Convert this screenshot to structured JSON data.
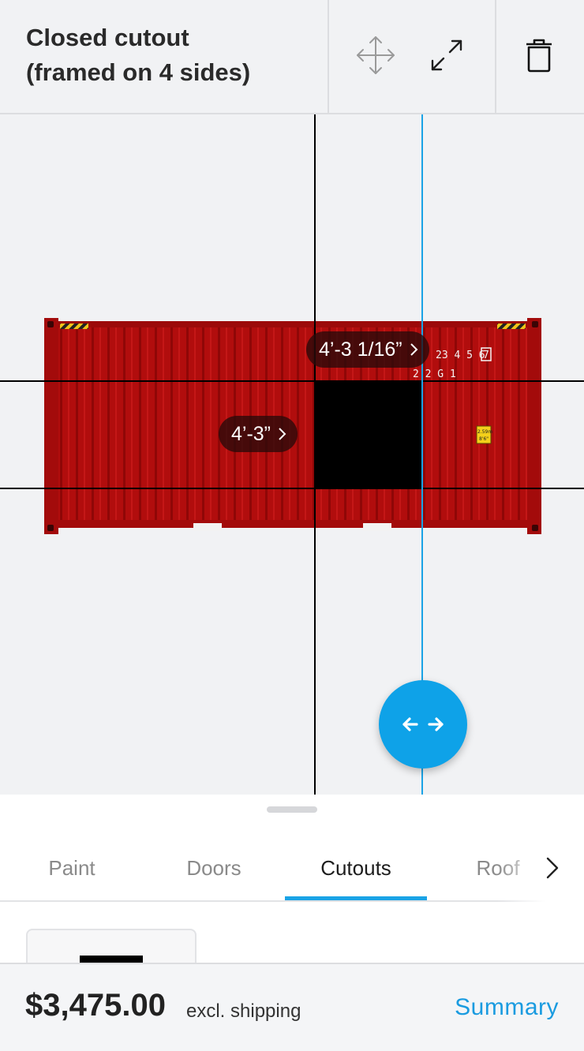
{
  "header": {
    "title_line1": "Closed cutout",
    "title_line2": "(framed on 4 sides)",
    "move_icon": "move-arrows-icon",
    "resize_icon": "expand-diagonal-icon",
    "delete_icon": "trash-icon"
  },
  "canvas": {
    "container_markings": {
      "code_line1": "23 4 5 6",
      "check_digit": "7",
      "code_line2": "2 2 G 1",
      "plate_line1": "2.59m",
      "plate_line2": "8'6\""
    },
    "dim_top_label": "4’-3 1/16”",
    "dim_left_label": "4’-3”",
    "fab_icon": "horizontal-arrows-icon",
    "colors": {
      "container_red": "#b10d0d",
      "guide_blue": "#1aa3e6",
      "cutout": "#000000"
    }
  },
  "tabs": [
    {
      "label": "Paint",
      "active": false
    },
    {
      "label": "Doors",
      "active": false
    },
    {
      "label": "Cutouts",
      "active": true
    },
    {
      "label": "Roof",
      "active": false
    }
  ],
  "footer": {
    "price": "$3,475.00",
    "price_note": "excl. shipping",
    "summary_label": "Summary"
  },
  "accent_color": "#1aa3e6"
}
